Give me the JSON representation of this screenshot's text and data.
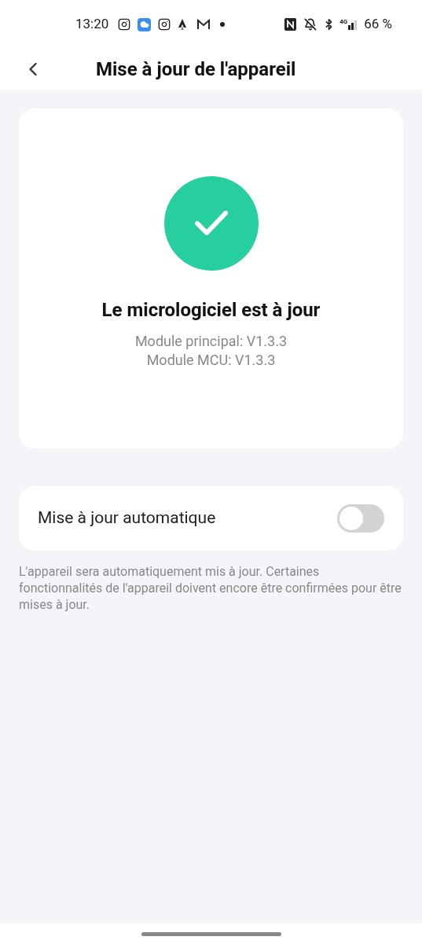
{
  "status_bar": {
    "time": "13:20",
    "network": "4G",
    "battery": "66 %"
  },
  "header": {
    "title": "Mise à jour de l'appareil"
  },
  "firmware": {
    "title": "Le micrologiciel est à jour",
    "versions": [
      "Module principal: V1.3.3",
      "Module MCU: V1.3.3"
    ]
  },
  "auto_update": {
    "label": "Mise à jour automatique",
    "on": false
  },
  "note": "L'appareil sera automatiquement mis à jour. Certaines fonctionnalités de l'appareil doivent encore être confirmées pour être mises à jour."
}
